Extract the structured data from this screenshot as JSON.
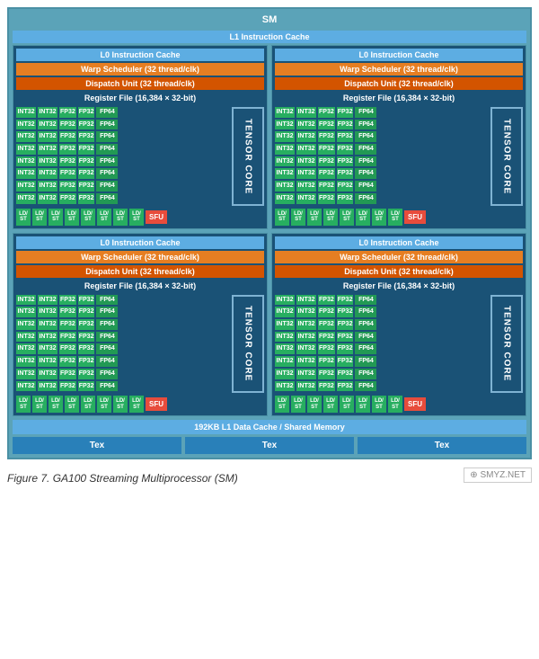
{
  "sm": {
    "title": "SM",
    "l1_cache_top": "L1 Instruction Cache",
    "l0_cache": "L0 Instruction Cache",
    "warp_scheduler": "Warp Scheduler (32 thread/clk)",
    "dispatch_unit": "Dispatch Unit (32 thread/clk)",
    "register_file": "Register File (16,384 × 32-bit)",
    "tensor_core": "TENSOR CORE",
    "sfu": "SFU",
    "l1_data_cache": "192KB L1 Data Cache / Shared Memory",
    "tex": "Tex",
    "rows": [
      {
        "int32a": "INT32",
        "int32b": "INT32",
        "fp32a": "FP32",
        "fp32b": "FP32",
        "fp64": "FP64"
      },
      {
        "int32a": "INT32",
        "int32b": "INT32",
        "fp32a": "FP32",
        "fp32b": "FP32",
        "fp64": "FP64"
      },
      {
        "int32a": "INT32",
        "int32b": "INT32",
        "fp32a": "FP32",
        "fp32b": "FP32",
        "fp64": "FP64"
      },
      {
        "int32a": "INT32",
        "int32b": "INT32",
        "fp32a": "FP32",
        "fp32b": "FP32",
        "fp64": "FP64"
      },
      {
        "int32a": "INT32",
        "int32b": "INT32",
        "fp32a": "FP32",
        "fp32b": "FP32",
        "fp64": "FP64"
      },
      {
        "int32a": "INT32",
        "int32b": "INT32",
        "fp32a": "FP32",
        "fp32b": "FP32",
        "fp64": "FP64"
      },
      {
        "int32a": "INT32",
        "int32b": "INT32",
        "fp32a": "FP32",
        "fp32b": "FP32",
        "fp64": "FP64"
      },
      {
        "int32a": "INT32",
        "int32b": "INT32",
        "fp32a": "FP32",
        "fp32b": "FP32",
        "fp64": "FP64"
      }
    ],
    "ld_st_labels": [
      "LD/ST",
      "LD/ST",
      "LD/ST",
      "LD/ST",
      "LD/ST",
      "LD/ST",
      "LD/ST",
      "LD/ST"
    ],
    "figure_caption": "Figure 7.    GA100 Streaming Multiprocessor (SM)",
    "watermark": "⊕ SMYZ.NET"
  }
}
